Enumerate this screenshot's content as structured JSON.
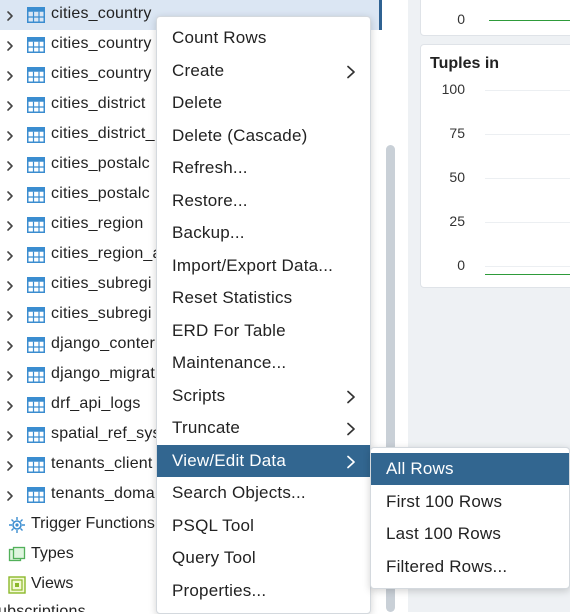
{
  "tree": {
    "tables": [
      {
        "label": "cities_country"
      },
      {
        "label": "cities_country"
      },
      {
        "label": "cities_country"
      },
      {
        "label": "cities_district"
      },
      {
        "label": "cities_district_"
      },
      {
        "label": "cities_postalc"
      },
      {
        "label": "cities_postalc"
      },
      {
        "label": "cities_region"
      },
      {
        "label": "cities_region_a"
      },
      {
        "label": "cities_subregi"
      },
      {
        "label": "cities_subregi"
      },
      {
        "label": "django_conter"
      },
      {
        "label": "django_migrat"
      },
      {
        "label": "drf_api_logs"
      },
      {
        "label": "spatial_ref_sys"
      },
      {
        "label": "tenants_client"
      },
      {
        "label": "tenants_doma"
      }
    ],
    "nodes": [
      {
        "label": "Trigger Functions",
        "icon": "trigger-functions-icon"
      },
      {
        "label": "Types",
        "icon": "types-icon"
      },
      {
        "label": "Views",
        "icon": "views-icon"
      }
    ],
    "partial_label": "ubscriptions"
  },
  "dashboard": {
    "top_tick": "0",
    "tuples_in": {
      "title": "Tuples in",
      "ticks": [
        "100",
        "75",
        "50",
        "25",
        "0"
      ]
    }
  },
  "context_menu": {
    "items": [
      {
        "label": "Count Rows",
        "submenu": false
      },
      {
        "label": "Create",
        "submenu": true
      },
      {
        "label": "Delete",
        "submenu": false
      },
      {
        "label": "Delete (Cascade)",
        "submenu": false
      },
      {
        "label": "Refresh...",
        "submenu": false
      },
      {
        "label": "Restore...",
        "submenu": false
      },
      {
        "label": "Backup...",
        "submenu": false
      },
      {
        "label": "Import/Export Data...",
        "submenu": false
      },
      {
        "label": "Reset Statistics",
        "submenu": false
      },
      {
        "label": "ERD For Table",
        "submenu": false
      },
      {
        "label": "Maintenance...",
        "submenu": false
      },
      {
        "label": "Scripts",
        "submenu": true
      },
      {
        "label": "Truncate",
        "submenu": true
      },
      {
        "label": "View/Edit Data",
        "submenu": true,
        "active": true
      },
      {
        "label": "Search Objects...",
        "submenu": false
      },
      {
        "label": "PSQL Tool",
        "submenu": false
      },
      {
        "label": "Query Tool",
        "submenu": false
      },
      {
        "label": "Properties...",
        "submenu": false
      }
    ],
    "submenu_items": [
      {
        "label": "All Rows",
        "active": true
      },
      {
        "label": "First 100 Rows"
      },
      {
        "label": "Last 100 Rows"
      },
      {
        "label": "Filtered Rows..."
      }
    ]
  },
  "colors": {
    "accent": "#326690",
    "selected_row": "#dbe6f3",
    "table_icon": "#3b8dd0",
    "chart_line": "#2e9b3a"
  }
}
